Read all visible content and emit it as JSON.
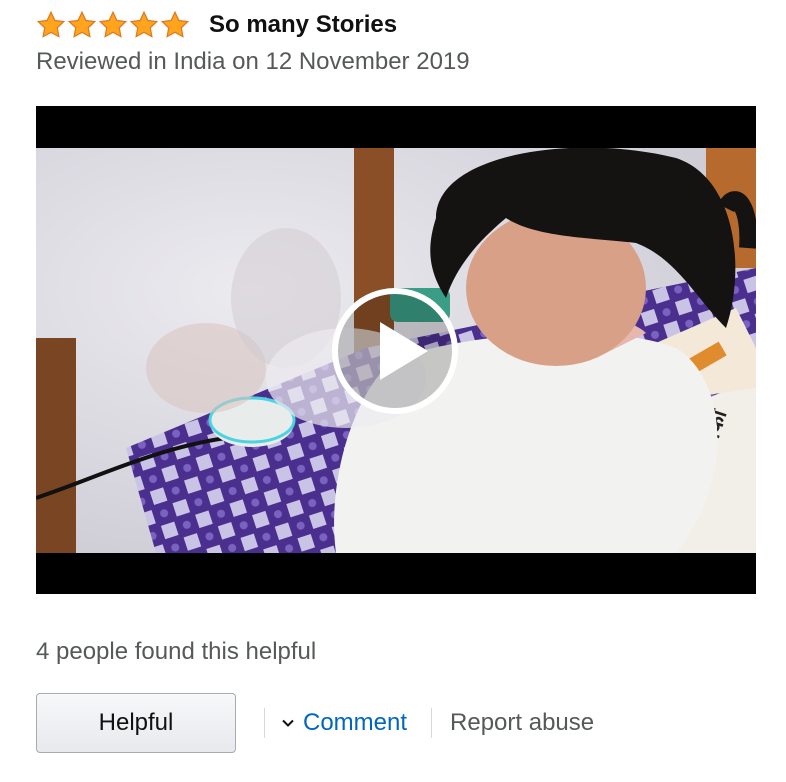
{
  "review": {
    "rating": 5,
    "rating_max": 5,
    "star_color": "#ffa41c",
    "title": "So many Stories",
    "meta": "Reviewed in India on 12 November 2019",
    "video": {
      "newspaper_text": "राजस्थान पत्रिका"
    },
    "helpful_count_text": "4 people found this helpful",
    "actions": {
      "helpful_label": "Helpful",
      "comment_label": "Comment",
      "report_label": "Report abuse"
    },
    "colors": {
      "link": "#0066c0",
      "secondary_text": "#565959"
    }
  }
}
